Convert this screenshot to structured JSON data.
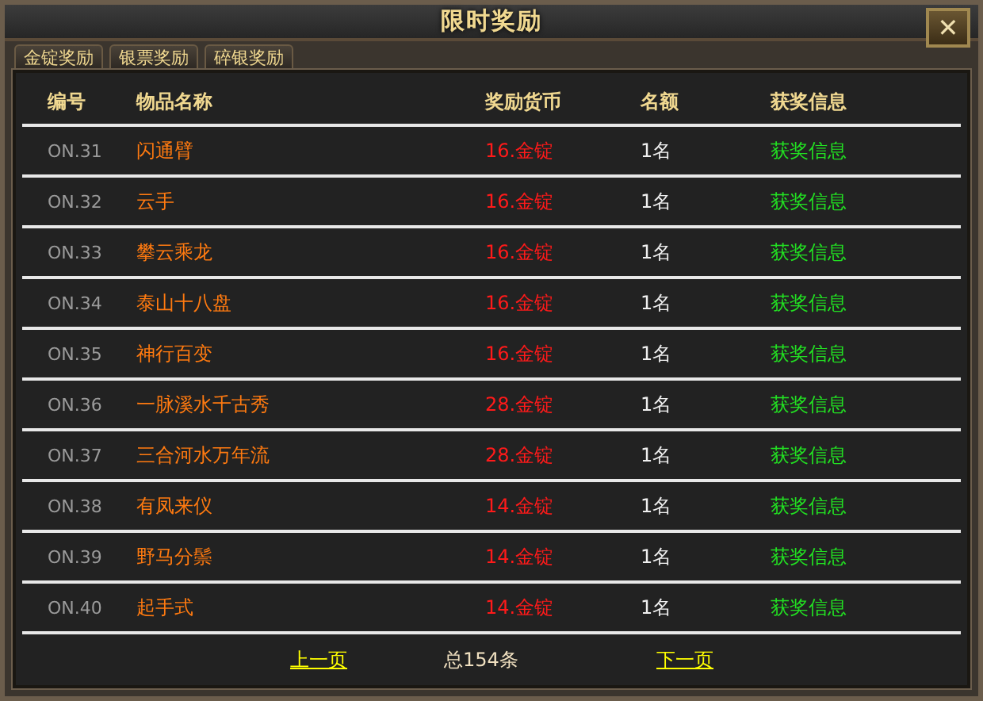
{
  "window": {
    "title": "限时奖励",
    "close": "✕"
  },
  "tabs": [
    {
      "label": "金锭奖励",
      "selected": false
    },
    {
      "label": "银票奖励",
      "selected": false
    },
    {
      "label": "碎银奖励",
      "selected": false
    }
  ],
  "table": {
    "columns": [
      "编号",
      "物品名称",
      "奖励货币",
      "名额",
      "获奖信息"
    ],
    "rows": [
      {
        "number": "ON.31",
        "item": "闪通臂",
        "currency": "16.金锭",
        "quota": "1名",
        "info": "获奖信息"
      },
      {
        "number": "ON.32",
        "item": "云手",
        "currency": "16.金锭",
        "quota": "1名",
        "info": "获奖信息"
      },
      {
        "number": "ON.33",
        "item": "攀云乘龙",
        "currency": "16.金锭",
        "quota": "1名",
        "info": "获奖信息"
      },
      {
        "number": "ON.34",
        "item": "泰山十八盘",
        "currency": "16.金锭",
        "quota": "1名",
        "info": "获奖信息"
      },
      {
        "number": "ON.35",
        "item": "神行百变",
        "currency": "16.金锭",
        "quota": "1名",
        "info": "获奖信息"
      },
      {
        "number": "ON.36",
        "item": "一脉溪水千古秀",
        "currency": "28.金锭",
        "quota": "1名",
        "info": "获奖信息"
      },
      {
        "number": "ON.37",
        "item": "三合河水万年流",
        "currency": "28.金锭",
        "quota": "1名",
        "info": "获奖信息"
      },
      {
        "number": "ON.38",
        "item": "有凤来仪",
        "currency": "14.金锭",
        "quota": "1名",
        "info": "获奖信息"
      },
      {
        "number": "ON.39",
        "item": "野马分鬃",
        "currency": "14.金锭",
        "quota": "1名",
        "info": "获奖信息"
      },
      {
        "number": "ON.40",
        "item": "起手式",
        "currency": "14.金锭",
        "quota": "1名",
        "info": "获奖信息"
      }
    ]
  },
  "pager": {
    "prev": "上一页",
    "total": "总154条",
    "next": "下一页"
  }
}
